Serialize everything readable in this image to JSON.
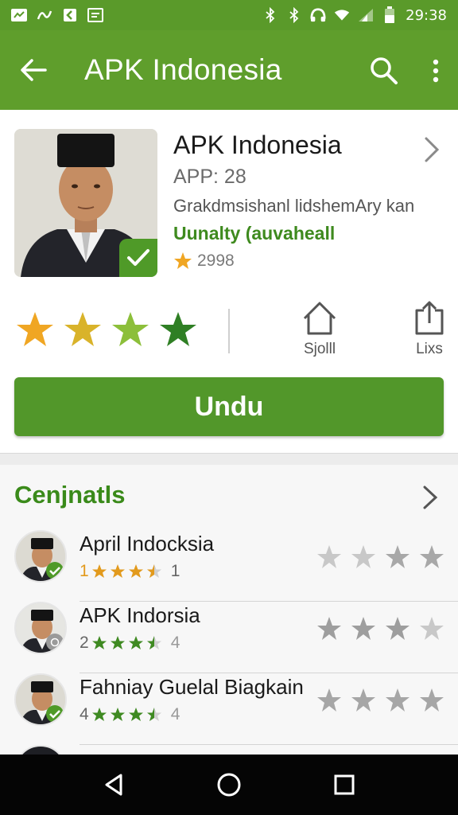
{
  "status_bar": {
    "time": "29:38",
    "left_icons": [
      "twitter-icon",
      "signal-app-icon",
      "tag-icon",
      "photo-icon"
    ],
    "right_icons": [
      "bluetooth-icon",
      "bluetooth-icon",
      "headphones-icon",
      "wifi-icon",
      "signal-icon",
      "battery-icon"
    ]
  },
  "app_bar": {
    "title": "APK Indonesia",
    "back_icon": "arrow-left-icon",
    "search_icon": "search-icon",
    "more_icon": "more-vertical-icon"
  },
  "app": {
    "name": "APK Indonesia",
    "version": "APP: 28",
    "description": "Grakdmsishanl lidshemAry kan",
    "quality": "Uunalty (auvaheall",
    "rating_count": "2998",
    "star_colors": [
      "#f0a623",
      "#d9b32a",
      "#8cbf3a",
      "#2f7f24"
    ],
    "actions": [
      {
        "label": "Sjolll",
        "icon": "home-icon"
      },
      {
        "label": "Lixs",
        "icon": "share-icon"
      }
    ],
    "install_label": "Undu"
  },
  "colors": {
    "primary": "#5f9e2c",
    "button": "#52972a",
    "accent_text": "#3a8a1a",
    "star_orange": "#f0a623",
    "star_green": "#3f8a22"
  },
  "related": {
    "title": "Cenjnatls",
    "items": [
      {
        "name": "April Indocksia",
        "lead": "1",
        "trail": "1",
        "mini_star_color": "#e29a1d",
        "badge": "check"
      },
      {
        "name": "APK Indorsia",
        "lead": "2",
        "trail": "4",
        "mini_star_color": "#3f8a22",
        "badge": "grey"
      },
      {
        "name": "Fahniay Guelal Biagkain",
        "lead": "4",
        "trail": "4",
        "mini_star_color": "#3f8a22",
        "badge": "check"
      }
    ]
  },
  "nav_bar": {
    "icons": [
      "back-triangle-icon",
      "home-circle-icon",
      "recents-square-icon"
    ]
  }
}
